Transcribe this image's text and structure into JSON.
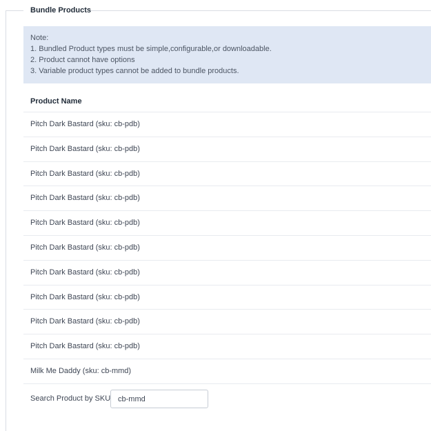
{
  "fieldset": {
    "legend": "Bundle Products"
  },
  "note": {
    "title": "Note:",
    "lines": [
      "1. Bundled Product types must be simple,configurable,or downloadable.",
      "2. Product cannot have options",
      "3. Variable product types cannot be added to bundle products."
    ]
  },
  "table": {
    "header": "Product Name",
    "rows": [
      "Pitch Dark Bastard (sku: cb-pdb)",
      "Pitch Dark Bastard (sku: cb-pdb)",
      "Pitch Dark Bastard (sku: cb-pdb)",
      "Pitch Dark Bastard (sku: cb-pdb)",
      "Pitch Dark Bastard (sku: cb-pdb)",
      "Pitch Dark Bastard (sku: cb-pdb)",
      "Pitch Dark Bastard (sku: cb-pdb)",
      "Pitch Dark Bastard (sku: cb-pdb)",
      "Pitch Dark Bastard (sku: cb-pdb)",
      "Pitch Dark Bastard (sku: cb-pdb)",
      "Milk Me Daddy (sku: cb-mmd)"
    ]
  },
  "search": {
    "label": "Search Product by SKU",
    "value": "cb-mmd"
  }
}
